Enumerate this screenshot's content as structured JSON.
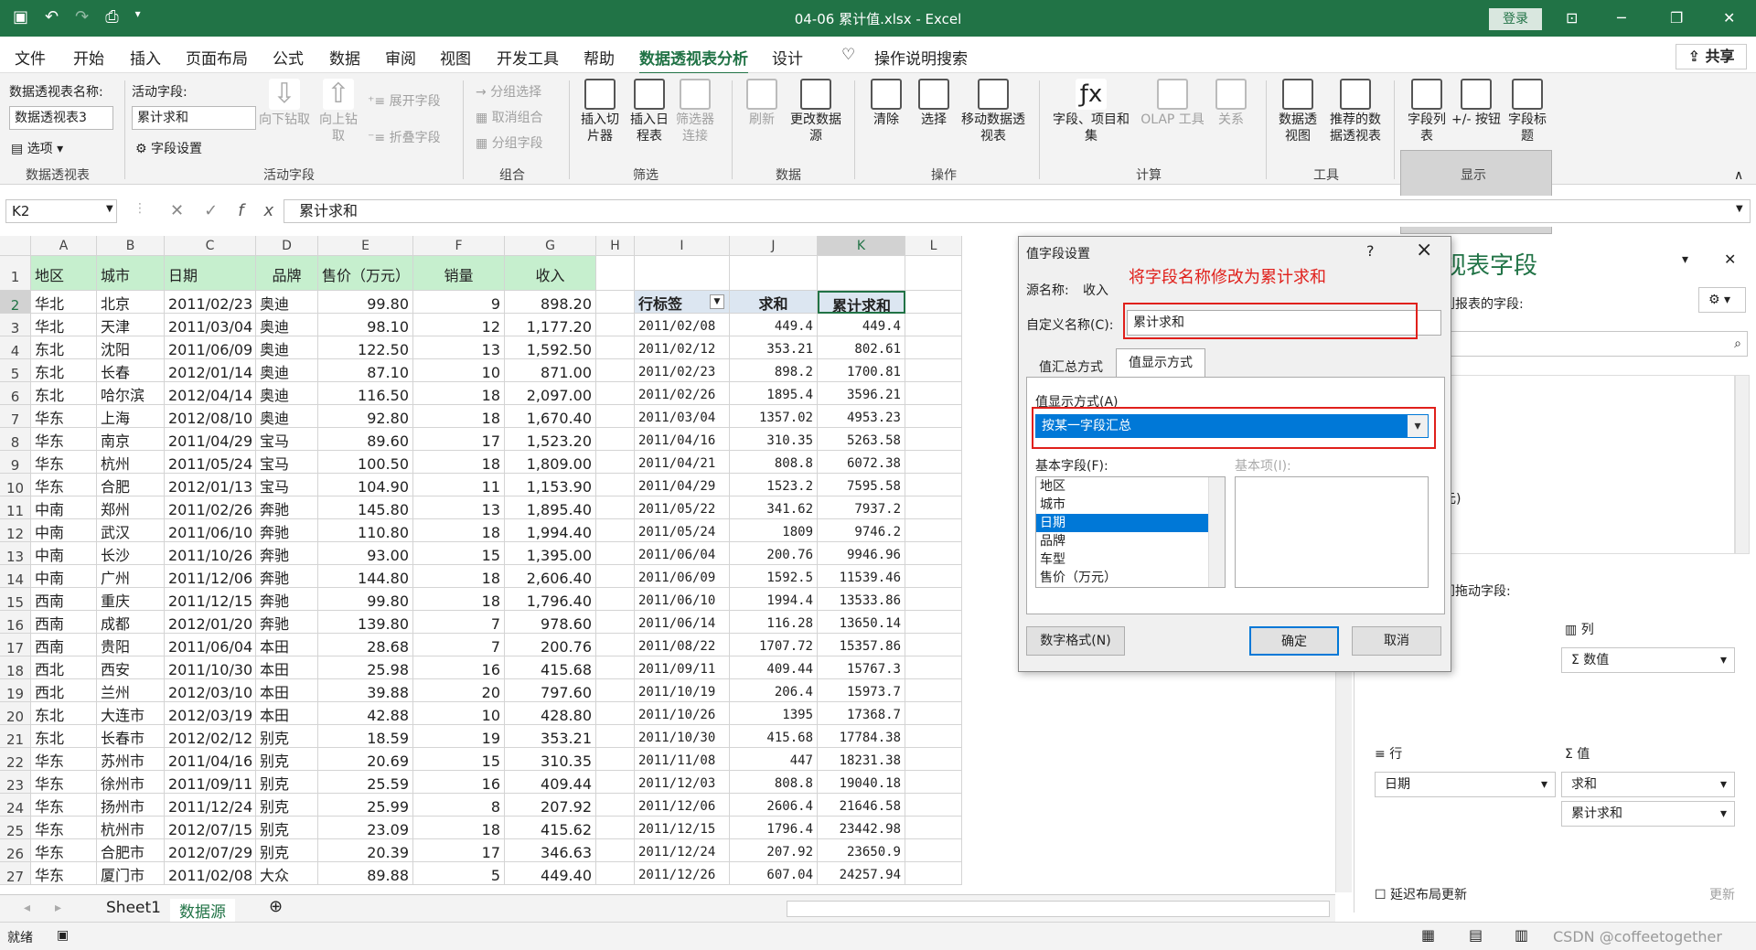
{
  "window": {
    "title": "04-06 累计值.xlsx  -  Excel",
    "login": "登录"
  },
  "menu": {
    "tabs": [
      "文件",
      "开始",
      "插入",
      "页面布局",
      "公式",
      "数据",
      "审阅",
      "视图",
      "开发工具",
      "帮助",
      "数据透视表分析",
      "设计"
    ],
    "active": "数据透视表分析",
    "search": "操作说明搜索",
    "share": "共享"
  },
  "ribbon": {
    "pt_name_label": "数据透视表名称:",
    "pt_name": "数据透视表3",
    "options": "选项",
    "group_pt": "数据透视表",
    "active_field_label": "活动字段:",
    "active_field": "累计求和",
    "field_settings": "字段设置",
    "drill_down": "向下钻取",
    "drill_up": "向上钻取",
    "expand": "展开字段",
    "collapse": "折叠字段",
    "group_active": "活动字段",
    "group_sel": "分组选择",
    "ungroup": "取消组合",
    "group_field": "分组字段",
    "group_group": "组合",
    "slicer": "插入切片器",
    "timeline": "插入日程表",
    "filter_conn": "筛选器连接",
    "group_filter": "筛选",
    "refresh": "刷新",
    "change_source": "更改数据源",
    "group_data": "数据",
    "clear": "清除",
    "select": "选择",
    "move": "移动数据透视表",
    "group_actions": "操作",
    "fields_items": "字段、项目和集",
    "olap": "OLAP 工具",
    "relations": "关系",
    "group_calc": "计算",
    "pivotchart": "数据透视图",
    "recommended": "推荐的数据透视表",
    "group_tools": "工具",
    "field_list": "字段列表",
    "buttons": "+/- 按钮",
    "field_headers": "字段标题",
    "group_show": "显示"
  },
  "formula": {
    "cell": "K2",
    "value": "累计求和"
  },
  "columns": [
    "A",
    "B",
    "C",
    "D",
    "E",
    "F",
    "G",
    "H",
    "I",
    "J",
    "K",
    "L"
  ],
  "source_headers": [
    "地区",
    "城市",
    "日期",
    "品牌",
    "售价（万元）",
    "销量",
    "收入"
  ],
  "source_rows": [
    [
      "华北",
      "北京",
      "2011/02/23",
      "奥迪",
      "99.80",
      "9",
      "898.20"
    ],
    [
      "华北",
      "天津",
      "2011/03/04",
      "奥迪",
      "98.10",
      "12",
      "1,177.20"
    ],
    [
      "东北",
      "沈阳",
      "2011/06/09",
      "奥迪",
      "122.50",
      "13",
      "1,592.50"
    ],
    [
      "东北",
      "长春",
      "2012/01/14",
      "奥迪",
      "87.10",
      "10",
      "871.00"
    ],
    [
      "东北",
      "哈尔滨",
      "2012/04/14",
      "奥迪",
      "116.50",
      "18",
      "2,097.00"
    ],
    [
      "华东",
      "上海",
      "2012/08/10",
      "奥迪",
      "92.80",
      "18",
      "1,670.40"
    ],
    [
      "华东",
      "南京",
      "2011/04/29",
      "宝马",
      "89.60",
      "17",
      "1,523.20"
    ],
    [
      "华东",
      "杭州",
      "2011/05/24",
      "宝马",
      "100.50",
      "18",
      "1,809.00"
    ],
    [
      "华东",
      "合肥",
      "2012/01/13",
      "宝马",
      "104.90",
      "11",
      "1,153.90"
    ],
    [
      "中南",
      "郑州",
      "2011/02/26",
      "奔驰",
      "145.80",
      "13",
      "1,895.40"
    ],
    [
      "中南",
      "武汉",
      "2011/06/10",
      "奔驰",
      "110.80",
      "18",
      "1,994.40"
    ],
    [
      "中南",
      "长沙",
      "2011/10/26",
      "奔驰",
      "93.00",
      "15",
      "1,395.00"
    ],
    [
      "中南",
      "广州",
      "2011/12/06",
      "奔驰",
      "144.80",
      "18",
      "2,606.40"
    ],
    [
      "西南",
      "重庆",
      "2011/12/15",
      "奔驰",
      "99.80",
      "18",
      "1,796.40"
    ],
    [
      "西南",
      "成都",
      "2012/01/20",
      "奔驰",
      "139.80",
      "7",
      "978.60"
    ],
    [
      "西南",
      "贵阳",
      "2011/06/04",
      "本田",
      "28.68",
      "7",
      "200.76"
    ],
    [
      "西北",
      "西安",
      "2011/10/30",
      "本田",
      "25.98",
      "16",
      "415.68"
    ],
    [
      "西北",
      "兰州",
      "2012/03/10",
      "本田",
      "39.88",
      "20",
      "797.60"
    ],
    [
      "东北",
      "大连市",
      "2012/03/19",
      "本田",
      "42.88",
      "10",
      "428.80"
    ],
    [
      "东北",
      "长春市",
      "2012/02/12",
      "别克",
      "18.59",
      "19",
      "353.21"
    ],
    [
      "华东",
      "苏州市",
      "2011/04/16",
      "别克",
      "20.69",
      "15",
      "310.35"
    ],
    [
      "华东",
      "徐州市",
      "2011/09/11",
      "别克",
      "25.59",
      "16",
      "409.44"
    ],
    [
      "华东",
      "扬州市",
      "2011/12/24",
      "别克",
      "25.99",
      "8",
      "207.92"
    ],
    [
      "华东",
      "杭州市",
      "2012/07/15",
      "别克",
      "23.09",
      "18",
      "415.62"
    ],
    [
      "华东",
      "合肥市",
      "2012/07/29",
      "别克",
      "20.39",
      "17",
      "346.63"
    ],
    [
      "华东",
      "厦门市",
      "2011/02/08",
      "大众",
      "89.88",
      "5",
      "449.40"
    ]
  ],
  "pivot_headers": [
    "行标签",
    "求和",
    "累计求和"
  ],
  "pivot_rows": [
    [
      "2011/02/08",
      "449.4",
      "449.4"
    ],
    [
      "2011/02/12",
      "353.21",
      "802.61"
    ],
    [
      "2011/02/23",
      "898.2",
      "1700.81"
    ],
    [
      "2011/02/26",
      "1895.4",
      "3596.21"
    ],
    [
      "2011/03/04",
      "1357.02",
      "4953.23"
    ],
    [
      "2011/04/16",
      "310.35",
      "5263.58"
    ],
    [
      "2011/04/21",
      "808.8",
      "6072.38"
    ],
    [
      "2011/04/29",
      "1523.2",
      "7595.58"
    ],
    [
      "2011/05/22",
      "341.62",
      "7937.2"
    ],
    [
      "2011/05/24",
      "1809",
      "9746.2"
    ],
    [
      "2011/06/04",
      "200.76",
      "9946.96"
    ],
    [
      "2011/06/09",
      "1592.5",
      "11539.46"
    ],
    [
      "2011/06/10",
      "1994.4",
      "13533.86"
    ],
    [
      "2011/06/14",
      "116.28",
      "13650.14"
    ],
    [
      "2011/08/22",
      "1707.72",
      "15357.86"
    ],
    [
      "2011/09/11",
      "409.44",
      "15767.3"
    ],
    [
      "2011/10/19",
      "206.4",
      "15973.7"
    ],
    [
      "2011/10/26",
      "1395",
      "17368.7"
    ],
    [
      "2011/10/30",
      "415.68",
      "17784.38"
    ],
    [
      "2011/11/08",
      "447",
      "18231.38"
    ],
    [
      "2011/12/03",
      "808.8",
      "19040.18"
    ],
    [
      "2011/12/06",
      "2606.4",
      "21646.58"
    ],
    [
      "2011/12/15",
      "1796.4",
      "23442.98"
    ],
    [
      "2011/12/24",
      "207.92",
      "23650.9"
    ],
    [
      "2011/12/26",
      "607.04",
      "24257.94"
    ]
  ],
  "dialog": {
    "title": "值字段设置",
    "help": "?",
    "close": "×",
    "annotation": "将字段名称修改为累计求和",
    "source_label": "源名称:",
    "source_value": "收入",
    "custom_label": "自定义名称(C):",
    "custom_value": "累计求和",
    "tab1": "值汇总方式",
    "tab2": "值显示方式",
    "show_as_label": "值显示方式(A)",
    "show_as_value": "按某一字段汇总",
    "base_field_label": "基本字段(F):",
    "base_item_label": "基本项(I):",
    "base_fields": [
      "地区",
      "城市",
      "日期",
      "品牌",
      "车型",
      "售价（万元）"
    ],
    "base_field_selected": "日期",
    "number_format": "数字格式(N)",
    "ok": "确定",
    "cancel": "取消"
  },
  "taskpane": {
    "title": "视表字段",
    "fields_label": "到报表的字段:",
    "partial_item": "元)",
    "drag_label": "间拖动字段:",
    "columns_label": "列",
    "columns_item": "Σ 数值",
    "rows_label": "行",
    "rows_item": "日期",
    "values_label": "值",
    "values_items": [
      "求和",
      "累计求和"
    ],
    "defer": "延迟布局更新",
    "update": "更新"
  },
  "sheets": {
    "tabs": [
      "Sheet1",
      "数据源"
    ],
    "active": "数据源"
  },
  "status": {
    "ready": "就绪",
    "watermark": "CSDN @coffeetogether"
  }
}
